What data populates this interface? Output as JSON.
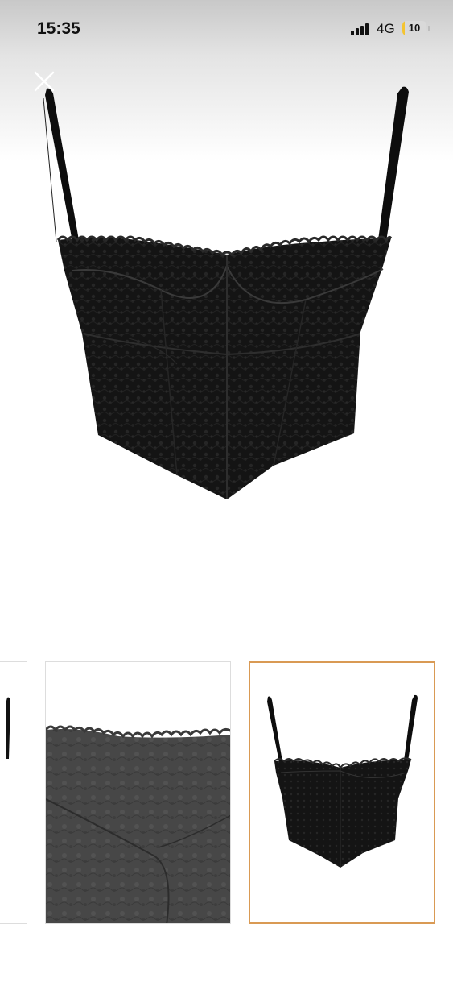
{
  "status_bar": {
    "time": "15:35",
    "network": "4G",
    "battery_level": "10",
    "battery_color": "#f4c430",
    "signal_icon": "cellular-signal-icon",
    "battery_icon": "battery-icon"
  },
  "viewer": {
    "close_icon": "close-icon",
    "main_image": "black-lace-corset-top-photo"
  },
  "thumbnails": {
    "selected_index": 2,
    "selected_border_color": "#d99a54",
    "items": [
      {
        "image": "corset-side-view-photo"
      },
      {
        "image": "lace-detail-closeup-photo"
      },
      {
        "image": "black-lace-corset-top-photo"
      }
    ]
  }
}
